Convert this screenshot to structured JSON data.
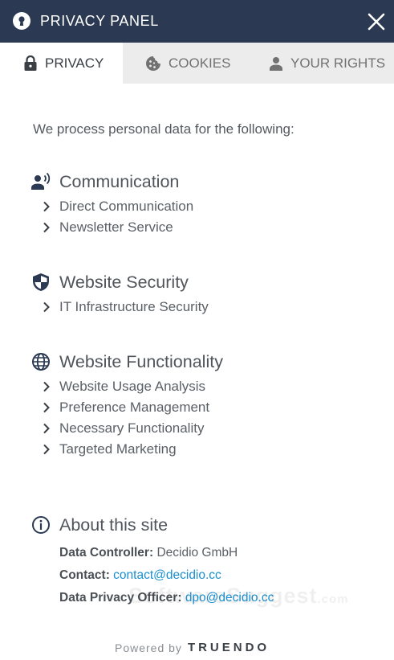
{
  "header": {
    "title": "PRIVACY PANEL",
    "logo_icon": "keyhole-icon",
    "close_icon": "close-icon"
  },
  "tabs": [
    {
      "label": "PRIVACY",
      "icon": "lock-icon",
      "active": true
    },
    {
      "label": "COOKIES",
      "icon": "cookie-icon",
      "active": false
    },
    {
      "label": "YOUR RIGHTS",
      "icon": "person-icon",
      "active": false
    }
  ],
  "intro": "We process personal data for the following:",
  "sections": [
    {
      "title": "Communication",
      "icon": "speaking-person-icon",
      "items": [
        "Direct Communication",
        "Newsletter Service"
      ]
    },
    {
      "title": "Website Security",
      "icon": "shield-icon",
      "items": [
        "IT Infrastructure Security"
      ]
    },
    {
      "title": "Website Functionality",
      "icon": "globe-icon",
      "items": [
        "Website Usage Analysis",
        "Preference Management",
        "Necessary Functionality",
        "Targeted Marketing"
      ]
    }
  ],
  "about": {
    "title": "About this site",
    "icon": "info-icon",
    "data_controller_label": "Data Controller:",
    "data_controller_value": "Decidio GmbH",
    "contact_label": "Contact:",
    "contact_value": "contact@decidio.cc",
    "dpo_label": "Data Privacy Officer:",
    "dpo_value": "dpo@decidio.cc"
  },
  "watermark": {
    "main": "SoftwareSuggest",
    "suffix": ".com"
  },
  "footer": {
    "powered_by": "Powered by",
    "brand": "TRUENDO"
  },
  "colors": {
    "header_bg": "#2b3a52",
    "tab_bar_bg": "#ececec",
    "link": "#1a8fd0",
    "text": "#555a60"
  }
}
